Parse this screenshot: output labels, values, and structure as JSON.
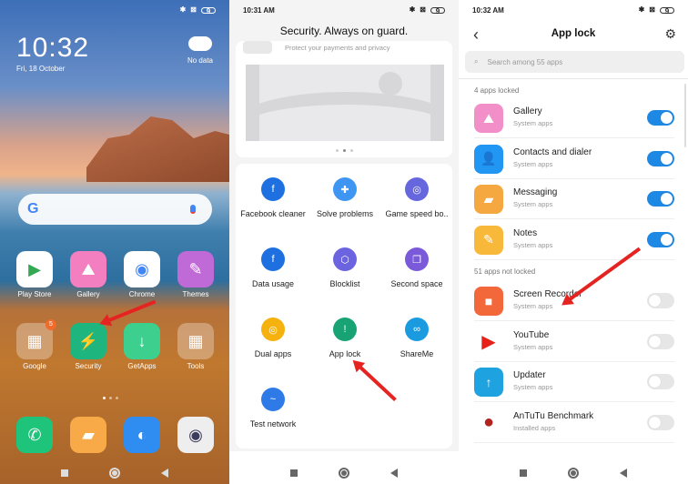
{
  "home": {
    "status_icons": [
      "bluetooth-icon",
      "sim-icon",
      "battery-icon"
    ],
    "battery": "9",
    "clock": "10:32",
    "date": "Fri, 18 October",
    "weather_label": "No data",
    "apps_row1": [
      {
        "label": "Play Store",
        "icon": "play-store-icon",
        "bg": "#ffffff",
        "glyph": "▶",
        "fg": "#34a853"
      },
      {
        "label": "Gallery",
        "icon": "gallery-icon",
        "bg": "#f47fc0",
        "glyph": "⛰",
        "fg": "#ffffff"
      },
      {
        "label": "Chrome",
        "icon": "chrome-icon",
        "bg": "#ffffff",
        "glyph": "◉",
        "fg": "#4285f4"
      },
      {
        "label": "Themes",
        "icon": "themes-icon",
        "bg": "#c06ad8",
        "glyph": "✎",
        "fg": "#ffffff"
      }
    ],
    "apps_row2": [
      {
        "label": "Google",
        "icon": "google-folder-icon",
        "bg": "rgba(255,255,255,0.3)",
        "glyph": "▦",
        "fg": "#ffffff",
        "badge": "5"
      },
      {
        "label": "Security",
        "icon": "security-icon",
        "bg": "#1fb57f",
        "glyph": "⚡",
        "fg": "#ffffff"
      },
      {
        "label": "GetApps",
        "icon": "getapps-icon",
        "bg": "#3ccf8e",
        "glyph": "↓",
        "fg": "#ffffff"
      },
      {
        "label": "Tools",
        "icon": "tools-folder-icon",
        "bg": "rgba(255,255,255,0.3)",
        "glyph": "▦",
        "fg": "#ffffff"
      }
    ],
    "dock": [
      {
        "icon": "phone-icon",
        "bg": "#1ec47a",
        "glyph": "✆",
        "fg": "#ffffff"
      },
      {
        "icon": "messaging-icon",
        "bg": "#f8a948",
        "glyph": "▰",
        "fg": "#ffffff"
      },
      {
        "icon": "browser-icon",
        "bg": "#2f8cf0",
        "glyph": "◐",
        "fg": "#ffffff"
      },
      {
        "icon": "camera-icon",
        "bg": "#eeeeee",
        "glyph": "◉",
        "fg": "#3b3b5c"
      }
    ]
  },
  "security": {
    "time": "10:31 AM",
    "battery": "9",
    "title": "Security. Always on guard.",
    "banner_subtitle": "Protect your payments and privacy",
    "tools": [
      {
        "label": "Facebook cleaner",
        "icon": "facebook-cleaner-icon",
        "color": "#1e6fe0",
        "glyph": "f"
      },
      {
        "label": "Solve problems",
        "icon": "solve-problems-icon",
        "color": "#3e95f2",
        "glyph": "✚"
      },
      {
        "label": "Game speed bo..",
        "icon": "game-speed-booster-icon",
        "color": "#6667de",
        "glyph": "◎"
      },
      {
        "label": "Data usage",
        "icon": "data-usage-icon",
        "color": "#1e6fe0",
        "glyph": "f"
      },
      {
        "label": "Blocklist",
        "icon": "blocklist-icon",
        "color": "#6c63e0",
        "glyph": "⬡"
      },
      {
        "label": "Second space",
        "icon": "second-space-icon",
        "color": "#7a5ad8",
        "glyph": "❐"
      },
      {
        "label": "Dual apps",
        "icon": "dual-apps-icon",
        "color": "#f5b20f",
        "glyph": "◎"
      },
      {
        "label": "App lock",
        "icon": "app-lock-icon",
        "color": "#17a374",
        "glyph": "!"
      },
      {
        "label": "ShareMe",
        "icon": "shareme-icon",
        "color": "#1a9be0",
        "glyph": "∞"
      },
      {
        "label": "Test network",
        "icon": "test-network-icon",
        "color": "#2e7be8",
        "glyph": "~"
      }
    ]
  },
  "applock": {
    "time": "10:32 AM",
    "battery": "9",
    "title": "App lock",
    "search_placeholder": "Search among 55 apps",
    "locked_header": "4 apps locked",
    "unlocked_header": "51 apps not locked",
    "locked": [
      {
        "name": "Gallery",
        "category": "System apps",
        "icon": "gallery-icon",
        "bg": "#f28fc8",
        "glyph": "⛰",
        "on": true
      },
      {
        "name": "Contacts and dialer",
        "category": "System apps",
        "icon": "contacts-icon",
        "bg": "#2196f3",
        "glyph": "👤",
        "on": true
      },
      {
        "name": "Messaging",
        "category": "System apps",
        "icon": "messaging-icon",
        "bg": "#f6a840",
        "glyph": "▰",
        "on": true
      },
      {
        "name": "Notes",
        "category": "System apps",
        "icon": "notes-icon",
        "bg": "#f8b93a",
        "glyph": "✎",
        "on": true
      }
    ],
    "unlocked": [
      {
        "name": "Screen Recorder",
        "category": "System apps",
        "icon": "screen-recorder-icon",
        "bg": "#f2683a",
        "glyph": "■",
        "on": false
      },
      {
        "name": "YouTube",
        "category": "System apps",
        "icon": "youtube-icon",
        "bg": "#ffffff",
        "glyph": "▶",
        "on": false
      },
      {
        "name": "Updater",
        "category": "System apps",
        "icon": "updater-icon",
        "bg": "#1fa2e0",
        "glyph": "↑",
        "on": false
      },
      {
        "name": "AnTuTu Benchmark",
        "category": "Installed apps",
        "icon": "antutu-icon",
        "bg": "#ffffff",
        "glyph": "●",
        "on": false
      }
    ]
  }
}
